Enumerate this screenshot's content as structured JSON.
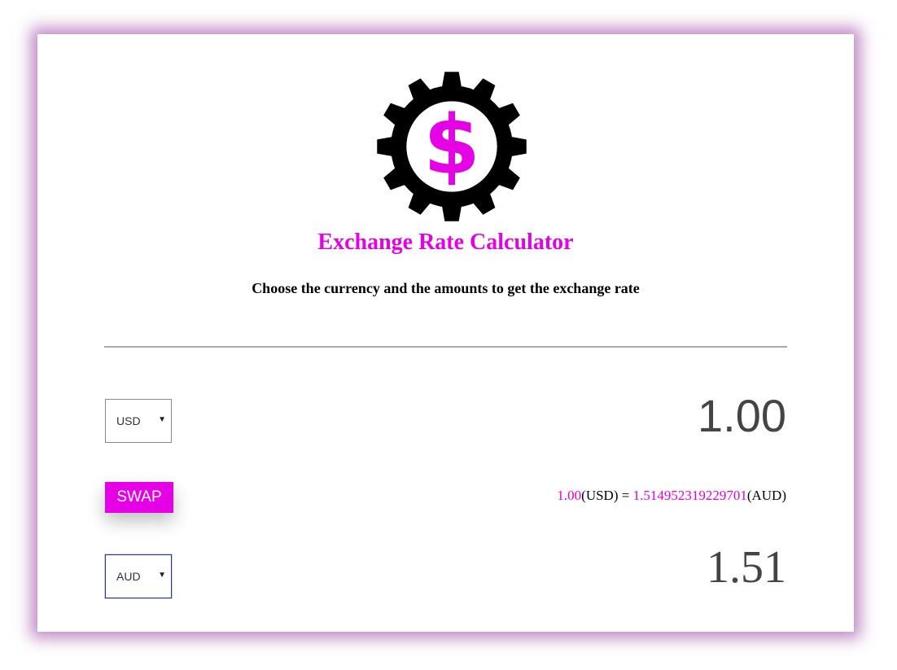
{
  "header": {
    "title": "Exchange Rate Calculator",
    "subtitle": "Choose the currency and the amounts to get the exchange rate"
  },
  "currency_one": {
    "selected": "USD",
    "amount": "1.00"
  },
  "swap_label": "SWAP",
  "rate": {
    "from_amount": "1.00",
    "from_code": "(USD)",
    "equals": " = ",
    "to_amount": "1.514952319229701",
    "to_code": "(AUD)"
  },
  "currency_two": {
    "selected": "AUD",
    "amount": "1.51"
  },
  "colors": {
    "accent": "#e600e6",
    "text": "#000000",
    "amount": "#444444"
  },
  "icons": {
    "logo": "gear-dollar-icon",
    "select_caret": "caret-down-icon"
  }
}
